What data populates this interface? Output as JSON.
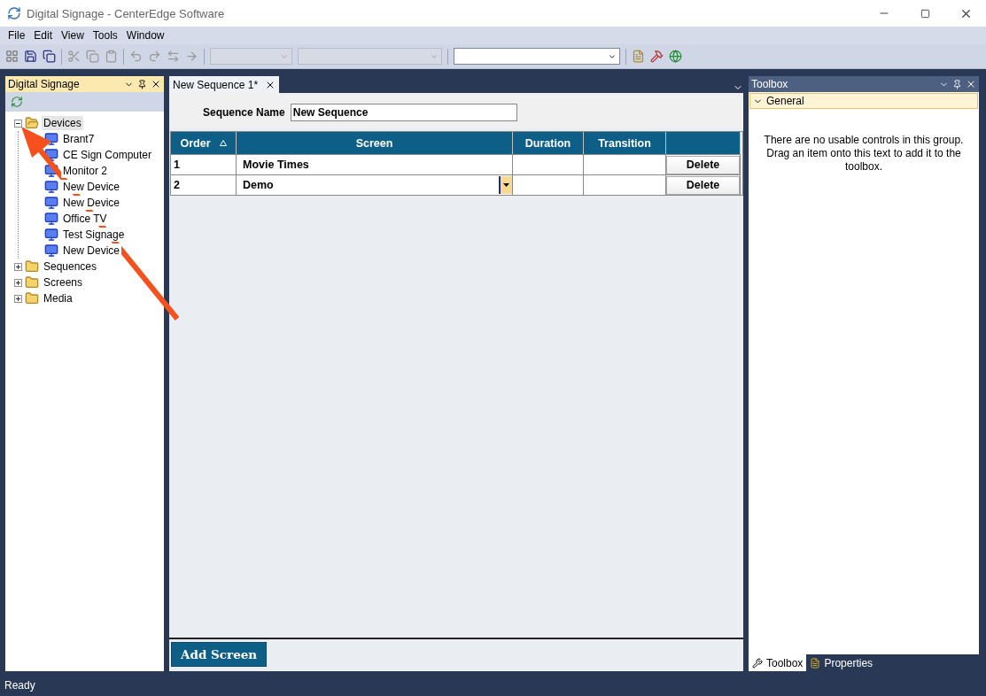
{
  "window": {
    "title": "Digital Signage - CenterEdge Software"
  },
  "menu": [
    "File",
    "Edit",
    "View",
    "Tools",
    "Window"
  ],
  "left_panel": {
    "title": "Digital Signage",
    "tree": [
      {
        "label": "Devices",
        "kind": "folder",
        "expanded": true,
        "selected": true,
        "children": [
          {
            "label": "Brant7",
            "kind": "device",
            "selected": false
          },
          {
            "label": "CE Sign Computer",
            "kind": "device",
            "selected": false
          },
          {
            "label": "Monitor 2",
            "kind": "device",
            "selected": false
          },
          {
            "label": "New Device",
            "kind": "device",
            "selected": false
          },
          {
            "label": "New Device",
            "kind": "device",
            "selected": false
          },
          {
            "label": "Office TV",
            "kind": "device",
            "selected": false
          },
          {
            "label": "Test Signage",
            "kind": "device",
            "selected": false
          },
          {
            "label": "New Device",
            "kind": "device",
            "selected": false
          }
        ]
      },
      {
        "label": "Sequences",
        "kind": "folder",
        "expanded": false,
        "selected": false
      },
      {
        "label": "Screens",
        "kind": "folder",
        "expanded": false,
        "selected": false
      },
      {
        "label": "Media",
        "kind": "folder",
        "expanded": false,
        "selected": false
      }
    ]
  },
  "document_tabs": [
    {
      "label": "New Sequence 1*",
      "selected": true
    }
  ],
  "sequence_name": {
    "label": "Sequence Name",
    "value": "New Sequence"
  },
  "table": {
    "columns": [
      {
        "label": "Order",
        "sorted": true
      },
      {
        "label": "Screen",
        "sorted": false
      },
      {
        "label": "Duration",
        "sorted": false
      },
      {
        "label": "Transition",
        "sorted": false
      },
      {
        "sorted": false
      }
    ],
    "rows": [
      {
        "order": "1",
        "screen": "Movie Times",
        "kind": "text",
        "duration": "",
        "transition": "",
        "action": "Delete"
      },
      {
        "order": "2",
        "screen": "Demo",
        "kind": "dropdown",
        "duration": "",
        "transition": "",
        "action": "Delete"
      }
    ]
  },
  "add_button": "Add Screen",
  "toolbox": {
    "title": "Toolbox",
    "group": {
      "label": "General",
      "expanded": true
    },
    "message": "There are no usable controls in this group. Drag an item onto this text to add it to the toolbox."
  },
  "bottom_tabs": [
    {
      "label": "Toolbox",
      "selected": true
    },
    {
      "label": "Properties",
      "selected": false
    }
  ],
  "status_bar": "Ready"
}
